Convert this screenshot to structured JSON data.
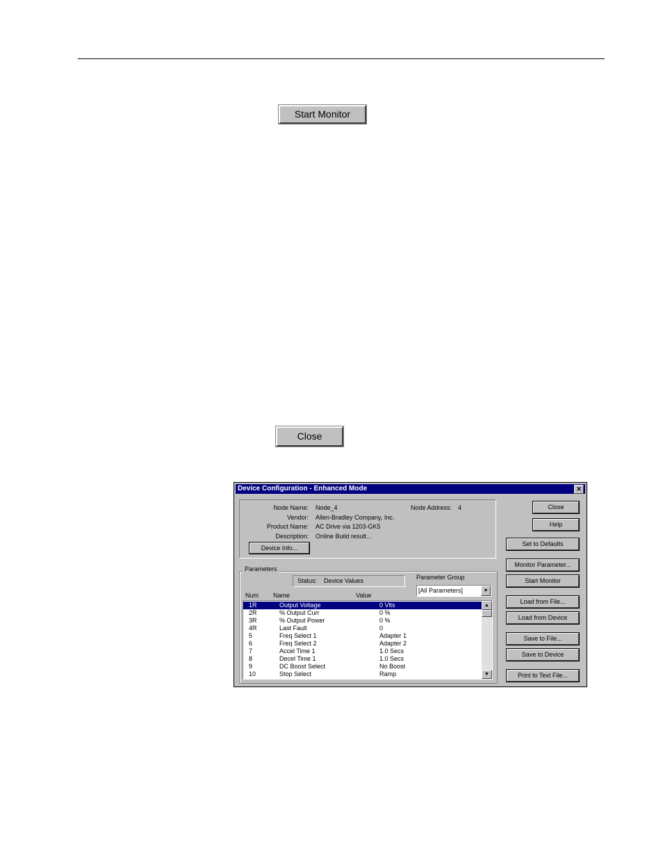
{
  "page": {
    "start_monitor_label": "Start Monitor",
    "close_label": "Close"
  },
  "dialog": {
    "title": "Device Configuration - Enhanced Mode",
    "close_glyph": "✕",
    "info": {
      "node_name_label": "Node Name:",
      "node_name": "Node_4",
      "node_address_label": "Node Address:",
      "node_address": "4",
      "vendor_label": "Vendor:",
      "vendor": "Allen-Bradley Company, Inc.",
      "product_name_label": "Product Name:",
      "product_name": "AC Drive via 1203-GK5",
      "description_label": "Description:",
      "description": "Online Build result...",
      "device_info_button": "Device Info..."
    },
    "buttons": {
      "close": "Close",
      "help": "Help",
      "set_to_defaults": "Set to Defaults",
      "monitor_parameter": "Monitor Parameter...",
      "start_monitor": "Start Monitor",
      "load_from_file": "Load from File...",
      "load_from_device": "Load from Device",
      "save_to_file": "Save to File...",
      "save_to_device": "Save to Device",
      "print_to_text_file": "Print to Text File..."
    },
    "parameters": {
      "group_title": "Parameters",
      "status_label": "Status:",
      "status_value": "Device Values",
      "parameter_group_label": "Parameter Group",
      "parameter_group_value": "[All Parameters]",
      "columns": {
        "num": "Num",
        "name": "Name",
        "value": "Value"
      },
      "rows": [
        {
          "num": "1R",
          "name": "Output Voltage",
          "value": "0 Vlts"
        },
        {
          "num": "2R",
          "name": "% Output Curr",
          "value": "0 %"
        },
        {
          "num": "3R",
          "name": "% Output Power",
          "value": "0 %"
        },
        {
          "num": "4R",
          "name": "Last Fault",
          "value": "0"
        },
        {
          "num": "5",
          "name": "Freq Select 1",
          "value": "Adapter 1"
        },
        {
          "num": "6",
          "name": "Freq Select 2",
          "value": "Adapter 2"
        },
        {
          "num": "7",
          "name": "Accel Time 1",
          "value": "1.0 Secs"
        },
        {
          "num": "8",
          "name": "Decel Time 1",
          "value": "1.0 Secs"
        },
        {
          "num": "9",
          "name": "DC Boost Select",
          "value": "No Boost"
        },
        {
          "num": "10",
          "name": "Stop Select",
          "value": "Ramp"
        }
      ],
      "selected_row": 0
    }
  },
  "icons": {
    "scroll_up": "▲",
    "scroll_down": "▼",
    "combo_down": "▼"
  }
}
